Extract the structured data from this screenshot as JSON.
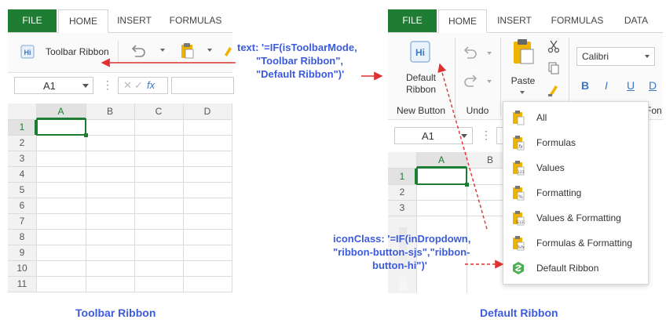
{
  "left": {
    "tabs": [
      "FILE",
      "HOME",
      "INSERT",
      "FORMULAS"
    ],
    "toolbar_ribbon_button": "Toolbar Ribbon",
    "cell_ref": "A1",
    "fx": "fx",
    "columns": [
      "A",
      "B",
      "C",
      "D"
    ],
    "rows": [
      "1",
      "2",
      "3",
      "4",
      "5",
      "6",
      "7",
      "8",
      "9",
      "10",
      "11"
    ],
    "caption": "Toolbar Ribbon"
  },
  "right": {
    "tabs": [
      "FILE",
      "HOME",
      "INSERT",
      "FORMULAS",
      "DATA"
    ],
    "default_ribbon_label_1": "Default",
    "default_ribbon_label_2": "Ribbon",
    "group_new_button": "New Button",
    "group_undo": "Undo",
    "paste_label": "Paste",
    "font_name": "Calibri",
    "font_buttons": [
      "B",
      "I",
      "U",
      "D"
    ],
    "group_font_partial": "Fon",
    "cell_ref": "A1",
    "columns": [
      "A",
      "B"
    ],
    "rows": [
      "1",
      "2",
      "3"
    ],
    "caption": "Default Ribbon",
    "paste_menu": [
      "All",
      "Formulas",
      "Values",
      "Formatting",
      "Values & Formatting",
      "Formulas & Formatting",
      "Default Ribbon"
    ]
  },
  "annotations": {
    "text_1": "text: '=IF(isToolbarMode,",
    "text_2": "\"Toolbar Ribbon\",",
    "text_3": "\"Default Ribbon\")'",
    "icon_1": "iconClass: '=IF(inDropdown,",
    "icon_2": "\"ribbon-button-sjs\",\"ribbon-",
    "icon_3": "button-hi\")'"
  },
  "colors": {
    "file_tab": "#1e7d32",
    "annotation": "#3b5bdb",
    "arrow": "#e03131",
    "active_cell": "#1e7d32"
  }
}
